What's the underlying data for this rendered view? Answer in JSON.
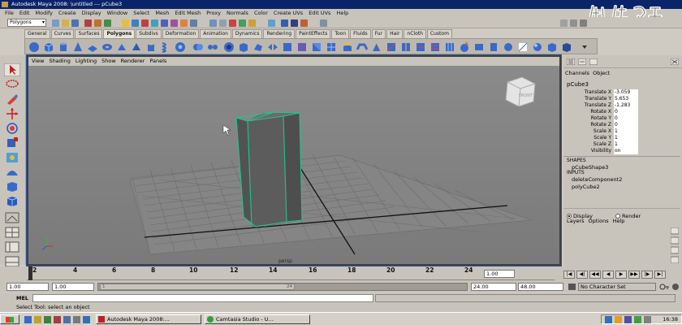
{
  "titlebar": {
    "title": "Autodesk Maya 2008: \\untitled   ---   pCube3"
  },
  "menubar": {
    "items": [
      "File",
      "Edit",
      "Modify",
      "Create",
      "Display",
      "Window",
      "Select",
      "Mesh",
      "Edit Mesh",
      "Proxy",
      "Normals",
      "Color",
      "Create UVs",
      "Edit UVs",
      "Help"
    ]
  },
  "statusline": {
    "mode": "Polygons"
  },
  "shelf": {
    "tabs": [
      "General",
      "Curves",
      "Surfaces",
      "Polygons",
      "Subdivs",
      "Deformation",
      "Animation",
      "Dynamics",
      "Rendering",
      "PaintEffects",
      "Toon",
      "Fluids",
      "Fur",
      "Hair",
      "nCloth",
      "Custom"
    ],
    "active_tab": "Polygons"
  },
  "viewport": {
    "menu": [
      "View",
      "Shading",
      "Lighting",
      "Show",
      "Renderer",
      "Panels"
    ],
    "camera": "persp",
    "viewcube_face": "FRONT"
  },
  "channelbox": {
    "menu": [
      "Channels",
      "Object"
    ],
    "object": "pCube3",
    "attributes": [
      {
        "label": "Translate X",
        "value": "-3.059"
      },
      {
        "label": "Translate Y",
        "value": "5.653"
      },
      {
        "label": "Translate Z",
        "value": "-1.283"
      },
      {
        "label": "Rotate X",
        "value": "0"
      },
      {
        "label": "Rotate Y",
        "value": "0"
      },
      {
        "label": "Rotate Z",
        "value": "0"
      },
      {
        "label": "Scale X",
        "value": "1"
      },
      {
        "label": "Scale Y",
        "value": "1"
      },
      {
        "label": "Scale Z",
        "value": "1"
      },
      {
        "label": "Visibility",
        "value": "on"
      }
    ],
    "shapes_label": "SHAPES",
    "shape": "pCubeShape3",
    "inputs_label": "INPUTS",
    "inputs": [
      "deleteComponent2",
      "polyCube2"
    ]
  },
  "layers": {
    "display_label": "Display",
    "render_label": "Render",
    "menu": [
      "Layers",
      "Options",
      "Help"
    ]
  },
  "timeslider": {
    "ticks": [
      "2",
      "4",
      "6",
      "8",
      "10",
      "12",
      "14",
      "16",
      "18",
      "20",
      "22",
      "24"
    ],
    "current_frame": "1.00"
  },
  "range": {
    "start": "1.00",
    "start_inner": "1.00",
    "handle_start": "1",
    "handle_end": "24",
    "end_inner": "24.00",
    "end": "48.00",
    "character_set": "No Character Set"
  },
  "commandline": {
    "label": "MEL"
  },
  "helpline": {
    "text": "Select Tool: select an object"
  },
  "taskbar": {
    "tasks": [
      "Autodesk Maya 2008:...",
      "Camtasia Studio - U..."
    ],
    "clock": "16:38"
  },
  "colors": {
    "title": "#0a246a",
    "viewport_bg": "#808080",
    "grid": "#6e6e6e",
    "object_edge": "#1fc68a"
  }
}
